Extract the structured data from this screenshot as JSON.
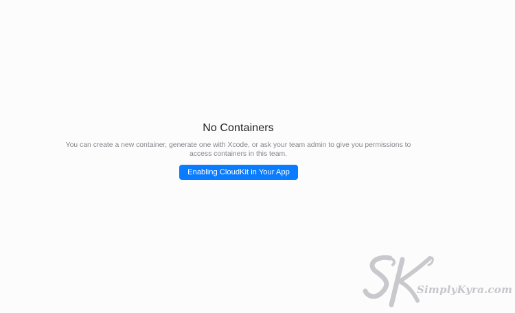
{
  "empty_state": {
    "title": "No Containers",
    "description": "You can create a new container, generate one with Xcode, or ask your team admin to give you permissions to access containers in this team.",
    "button_label": "Enabling CloudKit in Your App"
  },
  "watermark": {
    "text": "SimplyKyra.com"
  },
  "colors": {
    "accent": "#0a7cff",
    "background": "#fcfcfd",
    "title": "#1d1d1f",
    "secondary_text": "#86868b"
  }
}
